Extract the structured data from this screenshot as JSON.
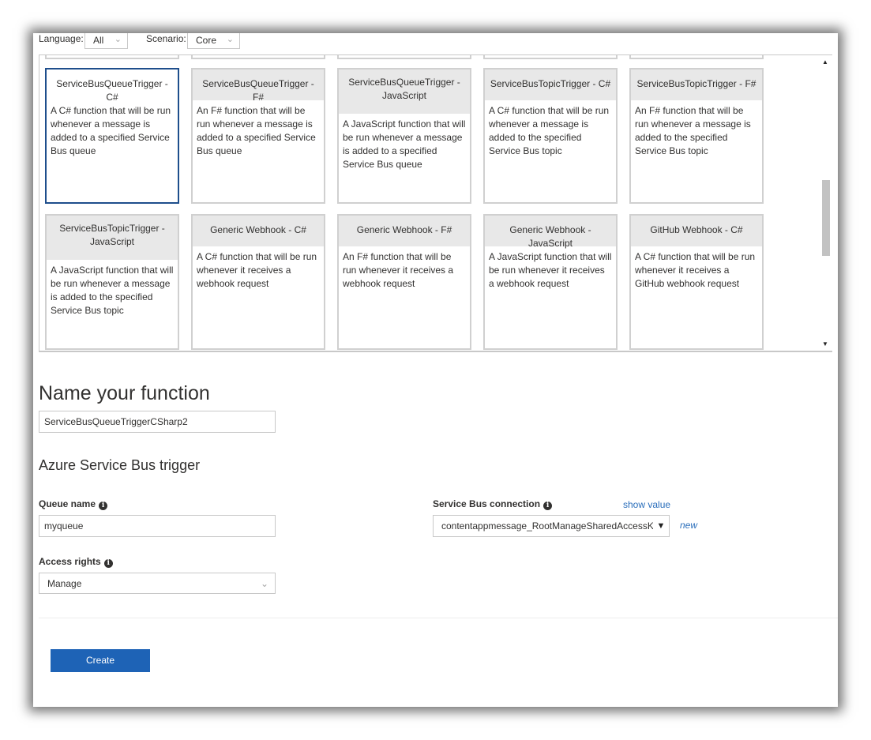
{
  "filters": {
    "language_label": "Language:",
    "language_value": "All",
    "scenario_label": "Scenario:",
    "scenario_value": "Core"
  },
  "templates": [
    {
      "title": "ServiceBusQueueTrigger - C#",
      "description": "A C# function that will be run whenever a message is added to a specified Service Bus queue",
      "selected": true
    },
    {
      "title": "ServiceBusQueueTrigger - F#",
      "description": "An F# function that will be run whenever a message is added to a specified Service Bus queue"
    },
    {
      "title": "ServiceBusQueueTrigger - JavaScript",
      "description": "A JavaScript function that will be run whenever a message is added to a specified Service Bus queue"
    },
    {
      "title": "ServiceBusTopicTrigger - C#",
      "description": "A C# function that will be run whenever a message is added to the specified Service Bus topic"
    },
    {
      "title": "ServiceBusTopicTrigger - F#",
      "description": "An F# function that will be run whenever a message is added to the specified Service Bus topic"
    },
    {
      "title": "ServiceBusTopicTrigger - JavaScript",
      "description": "A JavaScript function that will be run whenever a message is added to the specified Service Bus topic"
    },
    {
      "title": "Generic Webhook - C#",
      "description": "A C# function that will be run whenever it receives a webhook request"
    },
    {
      "title": "Generic Webhook - F#",
      "description": "An F# function that will be run whenever it receives a webhook request"
    },
    {
      "title": "Generic Webhook - JavaScript",
      "description": "A JavaScript function that will be run whenever it receives a webhook request"
    },
    {
      "title": "GitHub Webhook - C#",
      "description": "A C# function that will be run whenever it receives a GitHub webhook request"
    }
  ],
  "name_section": {
    "title": "Name your function",
    "function_name": "ServiceBusQueueTriggerCSharp2"
  },
  "trigger": {
    "title": "Azure Service Bus trigger",
    "queue_label": "Queue name",
    "queue_value": "myqueue",
    "connection_label": "Service Bus connection",
    "show_value_link": "show value",
    "connection_value": "contentappmessage_RootManageSharedAccessKey",
    "new_link": "new",
    "access_label": "Access rights",
    "access_value": "Manage"
  },
  "actions": {
    "create_label": "Create"
  }
}
